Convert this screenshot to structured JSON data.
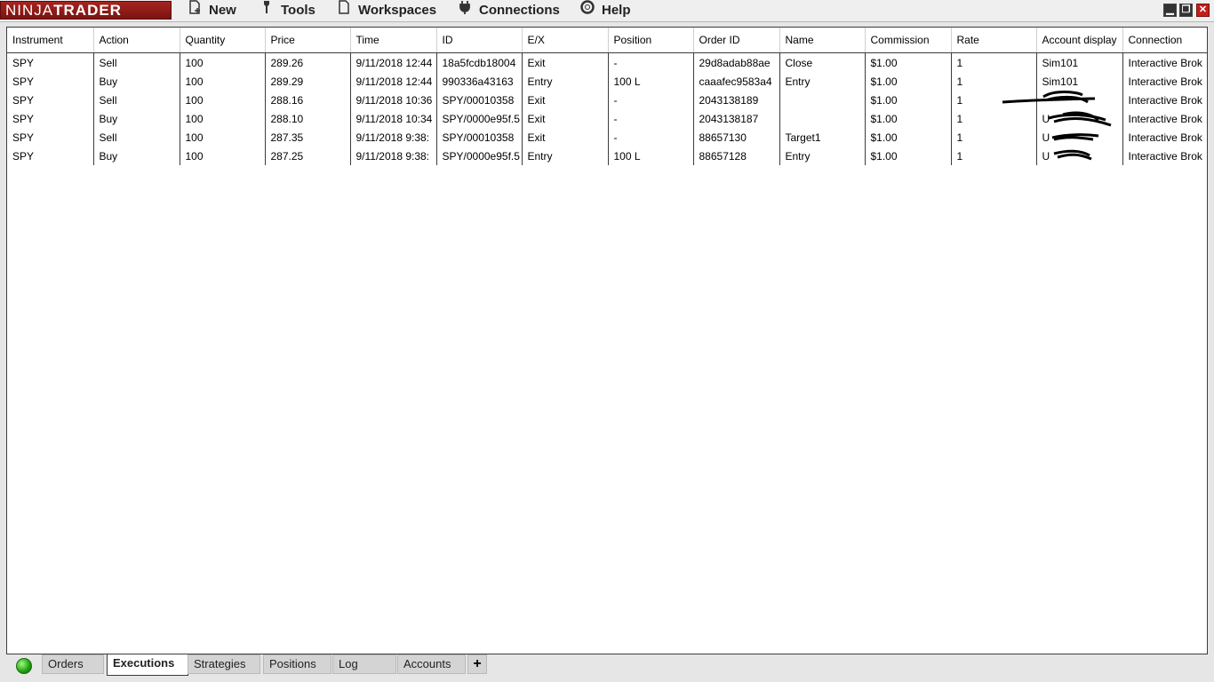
{
  "app": {
    "logo_part1": "NINJA",
    "logo_part2": "TRADER"
  },
  "menu": [
    {
      "label": "New",
      "icon": "new-document-icon"
    },
    {
      "label": "Tools",
      "icon": "wrench-icon"
    },
    {
      "label": "Workspaces",
      "icon": "document-icon"
    },
    {
      "label": "Connections",
      "icon": "plug-icon"
    },
    {
      "label": "Help",
      "icon": "lifebuoy-icon"
    }
  ],
  "window_buttons": [
    "minimize",
    "restore",
    "close"
  ],
  "grid": {
    "columns": [
      "Instrument",
      "Action",
      "Quantity",
      "Price",
      "Time",
      "ID",
      "E/X",
      "Position",
      "Order ID",
      "Name",
      "Commission",
      "Rate",
      "Account display",
      "Connection"
    ],
    "rows": [
      [
        "SPY",
        "Sell",
        "100",
        "289.26",
        "9/11/2018 12:44",
        "18a5fcdb18004",
        "Exit",
        "-",
        "29d8adab88ae",
        "Close",
        "$1.00",
        "1",
        "Sim101",
        "Interactive Brok"
      ],
      [
        "SPY",
        "Buy",
        "100",
        "289.29",
        "9/11/2018 12:44",
        "990336a43163",
        "Entry",
        "100 L",
        "caaafec9583a4",
        "Entry",
        "$1.00",
        "1",
        "Sim101",
        "Interactive Brok"
      ],
      [
        "SPY",
        "Sell",
        "100",
        "288.16",
        "9/11/2018 10:36",
        "SPY/00010358",
        "Exit",
        "-",
        "2043138189",
        "",
        "$1.00",
        "1",
        "",
        "Interactive Brok"
      ],
      [
        "SPY",
        "Buy",
        "100",
        "288.10",
        "9/11/2018 10:34",
        "SPY/0000e95f.5",
        "Exit",
        "-",
        "2043138187",
        "",
        "$1.00",
        "1",
        "U",
        "Interactive Brok"
      ],
      [
        "SPY",
        "Sell",
        "100",
        "287.35",
        "9/11/2018 9:38:",
        "SPY/00010358",
        "Exit",
        "-",
        "88657130",
        "Target1",
        "$1.00",
        "1",
        "U",
        "Interactive Brok"
      ],
      [
        "SPY",
        "Buy",
        "100",
        "287.25",
        "9/11/2018 9:38:",
        "SPY/0000e95f.5",
        "Entry",
        "100 L",
        "88657128",
        "Entry",
        "$1.00",
        "1",
        "U",
        "Interactive Brok"
      ]
    ]
  },
  "tabs": [
    {
      "label": "Orders",
      "active": false
    },
    {
      "label": "Executions",
      "active": true
    },
    {
      "label": "Strategies",
      "active": false
    },
    {
      "label": "Positions",
      "active": false
    },
    {
      "label": "Log",
      "active": false
    },
    {
      "label": "Accounts",
      "active": false
    }
  ],
  "add_tab_label": "+",
  "colors": {
    "logo_bg": "#8c1a16",
    "status_ok": "#1e9c12"
  }
}
